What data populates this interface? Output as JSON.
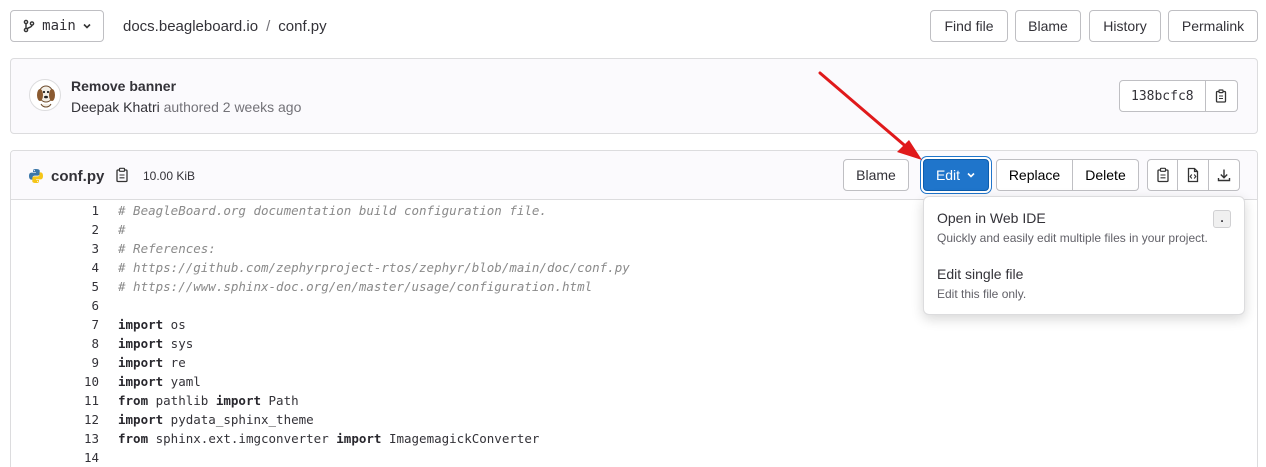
{
  "top": {
    "branch": "main",
    "breadcrumb": [
      "docs.beagleboard.io",
      "conf.py"
    ],
    "breadcrumb_sep": "/",
    "buttons": {
      "find_file": "Find file",
      "blame": "Blame",
      "history": "History",
      "permalink": "Permalink"
    }
  },
  "commit": {
    "title": "Remove banner",
    "author": "Deepak Khatri",
    "authored": "authored 2 weeks ago",
    "sha": "138bcfc8"
  },
  "file": {
    "name": "conf.py",
    "size": "10.00 KiB",
    "buttons": {
      "blame": "Blame",
      "edit": "Edit",
      "replace": "Replace",
      "delete": "Delete"
    }
  },
  "code_lines": [
    "# BeagleBoard.org documentation build configuration file.",
    "#",
    "# References:",
    "# https://github.com/zephyrproject-rtos/zephyr/blob/main/doc/conf.py",
    "# https://www.sphinx-doc.org/en/master/usage/configuration.html",
    "",
    "import os",
    "import sys",
    "import re",
    "import yaml",
    "from pathlib import Path",
    "import pydata_sphinx_theme",
    "from sphinx.ext.imgconverter import ImagemagickConverter",
    ""
  ],
  "edit_menu": {
    "items": [
      {
        "title": "Open in Web IDE",
        "desc": "Quickly and easily edit multiple files in your project.",
        "shortcut": "."
      },
      {
        "title": "Edit single file",
        "desc": "Edit this file only."
      }
    ]
  },
  "colors": {
    "primary": "#1f75cb",
    "annotation_arrow": "#e0191b"
  }
}
